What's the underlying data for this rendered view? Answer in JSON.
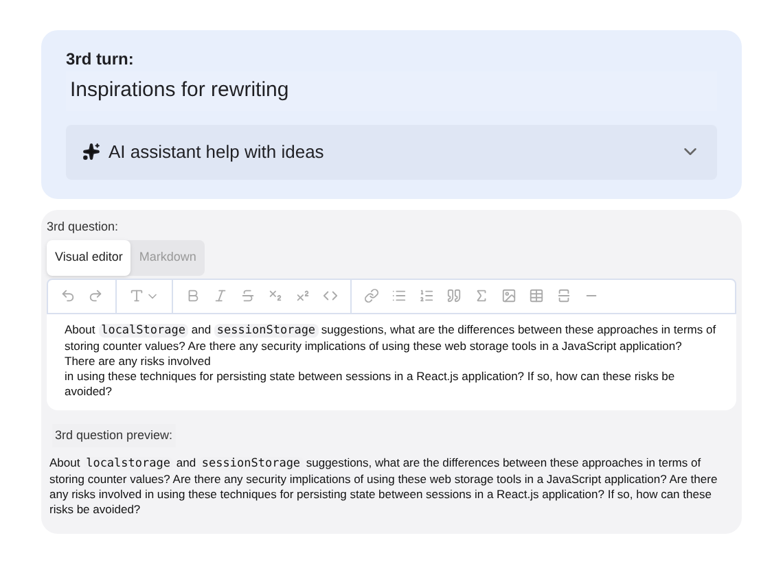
{
  "turn": {
    "label": "3rd turn:",
    "title": "Inspirations for rewriting",
    "assistant": {
      "label": "AI assistant help with ideas",
      "expanded": false
    }
  },
  "question": {
    "label": "3rd question:",
    "tabs": [
      {
        "label": "Visual editor",
        "selected": true
      },
      {
        "label": "Markdown",
        "selected": false
      }
    ],
    "paragraphs": [
      [
        {
          "kind": "text",
          "text": "About "
        },
        {
          "kind": "code",
          "text": "localStorage"
        },
        {
          "kind": "text",
          "text": " and "
        },
        {
          "kind": "code",
          "text": "sessionStorage"
        },
        {
          "kind": "text",
          "text": " suggestions, what are the differences between these approaches in terms of storing counter values? Are there any security implications of using these web storage tools in a JavaScript application?"
        }
      ],
      [
        {
          "kind": "text",
          "text": "There are any risks involved"
        }
      ],
      [
        {
          "kind": "text",
          "text": "in using these techniques for persisting state between sessions in a React.js application? If so, how can these risks be avoided?"
        }
      ]
    ]
  },
  "preview": {
    "label": "3rd question preview:",
    "segments": [
      {
        "kind": "text",
        "text": "About "
      },
      {
        "kind": "code",
        "text": "localstorage"
      },
      {
        "kind": "text",
        "text": " and "
      },
      {
        "kind": "code",
        "text": "sessionStorage"
      },
      {
        "kind": "text",
        "text": " suggestions, what are the differences between these approaches in terms of storing counter values? Are there any security implications of using these web storage tools in a JavaScript application? Are there any risks involved in using these techniques for persisting state between sessions in a React.js application? If so, how can these risks be avoided?"
      }
    ]
  }
}
